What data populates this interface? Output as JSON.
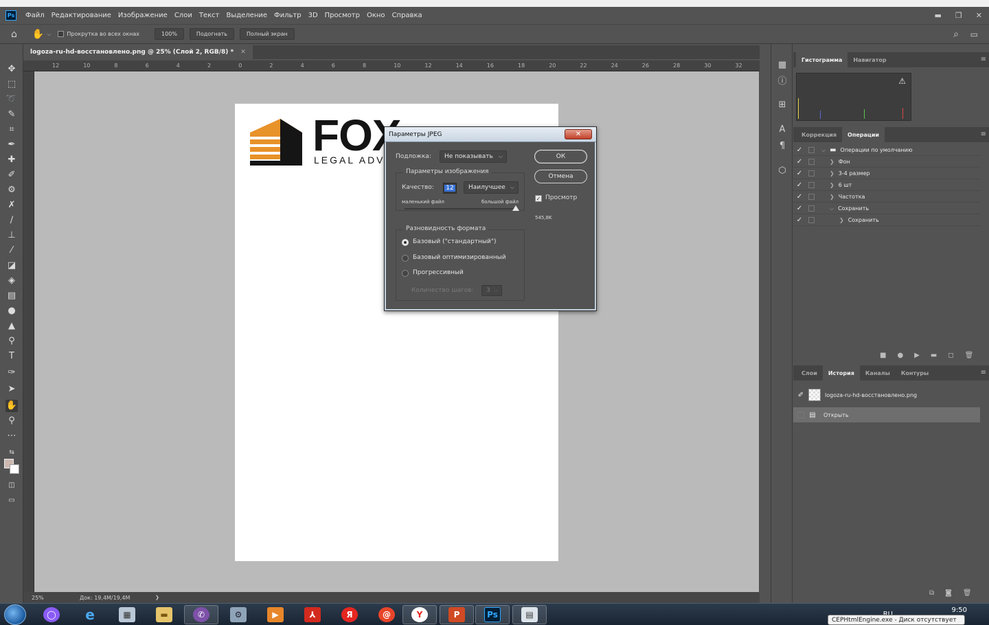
{
  "app": {
    "logo": "Ps",
    "menu": [
      "Файл",
      "Редактирование",
      "Изображение",
      "Слои",
      "Текст",
      "Выделение",
      "Фильтр",
      "3D",
      "Просмотр",
      "Окно",
      "Справка"
    ],
    "window_controls": [
      "minimize-icon",
      "restore-icon",
      "close-icon"
    ]
  },
  "options": {
    "scroll_all_label": "Прокрутка во всех окнах",
    "zoom_button": "100%",
    "fit_button": "Подогнать",
    "fullscreen_button": "Полный экран"
  },
  "document": {
    "tab_title": "logoza-ru-hd-восстановлено.png @ 25% (Слой 2, RGB/8) *",
    "logo_word": "FOX",
    "logo_sub": "LEGAL ADV"
  },
  "ruler": {
    "h_ticks": [
      "12",
      "10",
      "8",
      "6",
      "4",
      "2",
      "0",
      "2",
      "4",
      "6",
      "8",
      "10",
      "12",
      "14",
      "16",
      "18",
      "20",
      "22",
      "24",
      "26",
      "28",
      "30",
      "32"
    ]
  },
  "status": {
    "zoom": "25%",
    "doc": "Док: 19,4M/19,4M",
    "arrow": "❯"
  },
  "panels": {
    "top_tabs": [
      "Гистограмма",
      "Навигатор"
    ],
    "middle_tabs": [
      "Коррекция",
      "Операции"
    ],
    "actions": [
      {
        "label": "Операции по умолчанию",
        "twisty": "⌵",
        "folder": true
      },
      {
        "label": "Фон",
        "twisty": "❯"
      },
      {
        "label": "3-4 размер",
        "twisty": "❯"
      },
      {
        "label": "6 шт",
        "twisty": "❯"
      },
      {
        "label": "Частотка",
        "twisty": "❯"
      },
      {
        "label": "Сохранить",
        "twisty": "⌵"
      },
      {
        "label": "Сохранить",
        "twisty": "❯"
      }
    ],
    "bottom_tabs": [
      "Слои",
      "История",
      "Каналы",
      "Контуры"
    ],
    "history_snapshot": "logoza-ru-hd-восстановлено.png",
    "history_items": [
      "Открыть"
    ]
  },
  "dialog": {
    "title": "Параметры JPEG",
    "close": "✕",
    "matte_label": "Подложка:",
    "matte_value": "Не показывать",
    "image_options_title": "Параметры изображения",
    "quality_label": "Качество:",
    "quality_value": "12",
    "quality_preset": "Наилучшее",
    "small_file": "маленький файл",
    "large_file": "большой файл",
    "quality_slider": 1.0,
    "format_title": "Разновидность формата",
    "formats": [
      "Базовый (\"стандартный\")",
      "Базовый оптимизированный",
      "Прогрессивный"
    ],
    "selected_format": 0,
    "scans_label": "Количество шагов:",
    "scans_value": "3",
    "ok": "ОК",
    "cancel": "Отмена",
    "preview_label": "Просмотр",
    "preview_checked": true,
    "file_size": "545,8K"
  },
  "taskbar": {
    "apps": [
      "ie",
      "calc",
      "explorer",
      "viber",
      "install",
      "player",
      "acrobat",
      "Я",
      "mail",
      "Y",
      "P",
      "Ps",
      "app"
    ],
    "lang": "RU",
    "time": "9:50",
    "tooltip": "CEPHtmlEngine.exe - Диск отсутствует"
  },
  "colors": {
    "accent": "#31a8ff",
    "fox_orange": "#e8922a",
    "panel_bg": "#535353",
    "canvas_bg": "#bababa"
  }
}
